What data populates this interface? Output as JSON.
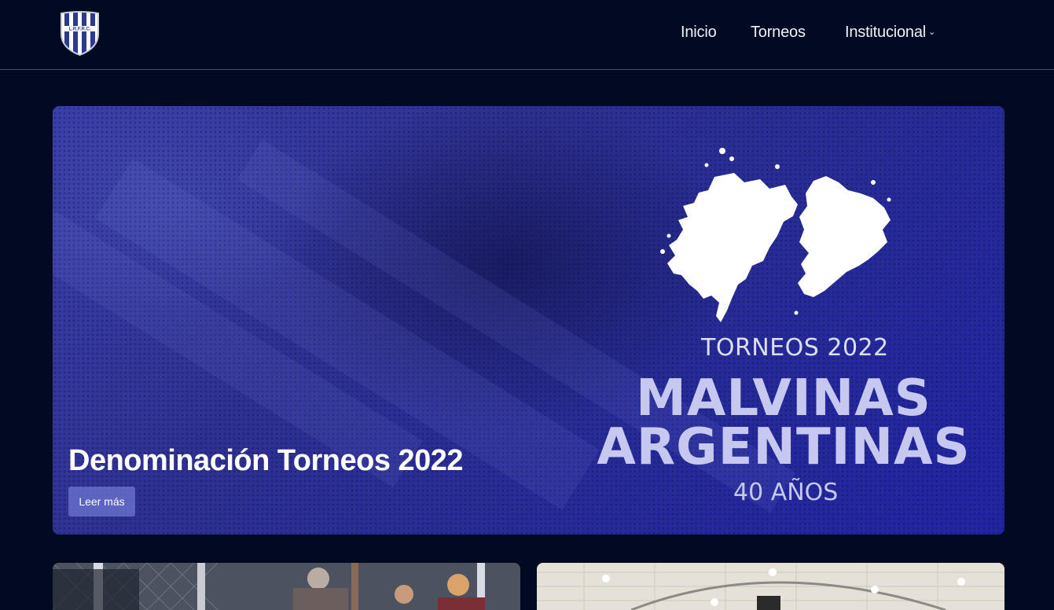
{
  "brand": {
    "logo_text": "L.R.F.R.C.",
    "logo_icon": "club-shield-icon",
    "colors": {
      "primary": "#2f3192",
      "navy": "#020a22",
      "stripe": "#2b3a8f"
    }
  },
  "nav": {
    "items": [
      {
        "label": "Inicio"
      },
      {
        "label": "Torneos"
      },
      {
        "label": "Institucional",
        "has_dropdown": true
      }
    ],
    "dropdown_icon": "chevron-down-icon"
  },
  "hero": {
    "title": "Denominación Torneos 2022",
    "button_label": "Leer más",
    "poster": {
      "subtitle": "TORNEOS 2022",
      "line1": "MALVINAS",
      "line2": "ARGENTINAS",
      "years": "40 AÑOS",
      "graphic": "malvinas-islands-map"
    }
  },
  "cards": [
    {
      "image": "players-photo"
    },
    {
      "image": "indoor-hall-photo"
    }
  ]
}
